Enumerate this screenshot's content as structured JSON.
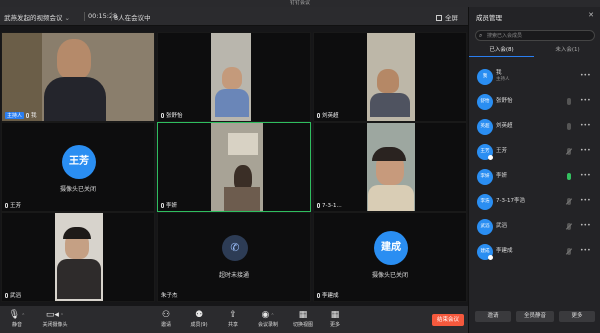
{
  "app": {
    "window_title": "钉钉会议"
  },
  "toolbar": {
    "meeting_title": "武燕发起的视频会议",
    "timer": "00:15:28",
    "participant_count": "8人在会议中",
    "fullscreen_label": "全屏"
  },
  "tiles": [
    {
      "name": "我",
      "host_badge": "主持人"
    },
    {
      "name": "张舒怡"
    },
    {
      "name": "刘英超"
    },
    {
      "name": "王芳",
      "avatar_text": "王芳",
      "status": "摄像头已关闭"
    },
    {
      "name": "李妍"
    },
    {
      "name": "7-3-1..."
    },
    {
      "name": "武滔"
    },
    {
      "name": "朱子杰",
      "status": "超时未接通"
    },
    {
      "name": "李建成",
      "avatar_text": "建成",
      "status": "摄像头已关闭"
    }
  ],
  "bottom": {
    "mute": "静音",
    "camera_off": "关闭摄像头",
    "invite": "邀请",
    "members": "成员(9)",
    "share": "共享",
    "record": "会议录制",
    "switch_view": "切换视图",
    "more": "更多",
    "end_meeting": "结束会议"
  },
  "panel": {
    "title": "成员管理",
    "search_placeholder": "搜索已入会成员",
    "tab_joined": "已入会(8)",
    "tab_not_joined": "未入会(1)",
    "members": [
      {
        "avatar": "我",
        "name": "我",
        "role": "主持人"
      },
      {
        "avatar": "舒怡",
        "name": "张舒怡"
      },
      {
        "avatar": "英超",
        "name": "刘英超"
      },
      {
        "avatar": "王芳",
        "name": "王芳"
      },
      {
        "avatar": "李妍",
        "name": "李妍"
      },
      {
        "avatar": "李浩",
        "name": "7-3-17李浩"
      },
      {
        "avatar": "武滔",
        "name": "武滔"
      },
      {
        "avatar": "建成",
        "name": "李建成"
      }
    ],
    "more_dots": "•••",
    "btn_invite": "邀请",
    "btn_mute_all": "全员静音",
    "btn_more": "更多"
  },
  "colors": {
    "accent": "#2a7ef0",
    "avatar": "#2a8ef2",
    "active_border": "#2fbd5f",
    "end": "#f5593d"
  }
}
